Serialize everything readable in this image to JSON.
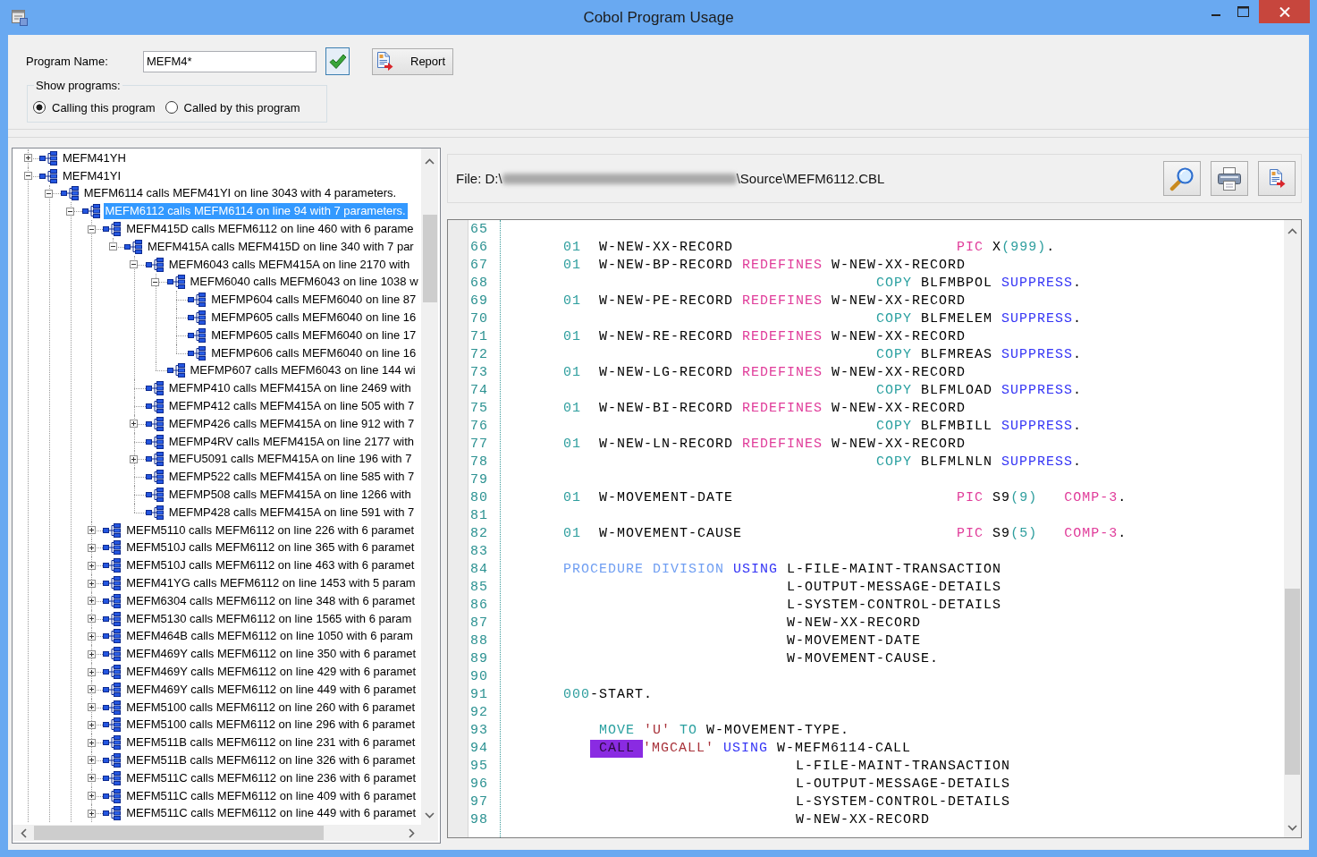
{
  "window": {
    "title": "Cobol Program Usage"
  },
  "program_name": {
    "label": "Program Name:",
    "value": "MEFM4*"
  },
  "report_button": {
    "label": "Report"
  },
  "show_programs": {
    "legend": "Show programs:",
    "options": [
      {
        "label": "Calling this program",
        "selected": true
      },
      {
        "label": "Called by this program",
        "selected": false
      }
    ]
  },
  "tree": {
    "items": [
      {
        "label": "MEFM41YH",
        "kind": "branch",
        "expanded": false,
        "selected": false
      },
      {
        "label": "MEFM41YI",
        "kind": "branch",
        "expanded": true,
        "selected": false,
        "children": [
          {
            "label": "MEFM6114 calls MEFM41YI on line 3043 with 4 parameters.",
            "kind": "branch",
            "expanded": true,
            "selected": false,
            "children": [
              {
                "label": "MEFM6112 calls MEFM6114 on line 94 with 7 parameters.",
                "kind": "branch",
                "expanded": true,
                "selected": true,
                "children": [
                  {
                    "label": "MEFM415D calls MEFM6112 on line 460 with 6 parame",
                    "kind": "branch",
                    "expanded": true,
                    "selected": false,
                    "children": [
                      {
                        "label": "MEFM415A calls MEFM415D on line 340 with 7 par",
                        "kind": "branch",
                        "expanded": true,
                        "selected": false,
                        "children": [
                          {
                            "label": "MEFM6043 calls MEFM415A on line 2170 with",
                            "kind": "branch",
                            "expanded": true,
                            "selected": false,
                            "children": [
                              {
                                "label": "MEFM6040 calls MEFM6043 on line 1038 w",
                                "kind": "branch",
                                "expanded": true,
                                "selected": false,
                                "children": [
                                  {
                                    "label": "MEFMP604 calls MEFM6040 on line 87",
                                    "kind": "leaf",
                                    "selected": false
                                  },
                                  {
                                    "label": "MEFMP605 calls MEFM6040 on line 16",
                                    "kind": "leaf",
                                    "selected": false
                                  },
                                  {
                                    "label": "MEFMP605 calls MEFM6040 on line 17",
                                    "kind": "leaf",
                                    "selected": false
                                  },
                                  {
                                    "label": "MEFMP606 calls MEFM6040 on line 16",
                                    "kind": "leaf",
                                    "selected": false
                                  }
                                ]
                              },
                              {
                                "label": "MEFMP607 calls MEFM6043 on line 144 wi",
                                "kind": "leaf",
                                "selected": false
                              }
                            ]
                          },
                          {
                            "label": "MEFMP410 calls MEFM415A on line 2469 with",
                            "kind": "leaf",
                            "selected": false
                          },
                          {
                            "label": "MEFMP412 calls MEFM415A on line 505 with 7",
                            "kind": "leaf",
                            "selected": false
                          },
                          {
                            "label": "MEFMP426 calls MEFM415A on line 912 with 7",
                            "kind": "branch",
                            "expanded": false,
                            "selected": false
                          },
                          {
                            "label": "MEFMP4RV calls MEFM415A on line 2177 with",
                            "kind": "leaf",
                            "selected": false
                          },
                          {
                            "label": "MEFU5091 calls MEFM415A on line 196 with 7",
                            "kind": "branch",
                            "expanded": false,
                            "selected": false
                          },
                          {
                            "label": "MEFMP522 calls MEFM415A on line 585 with 7",
                            "kind": "leaf",
                            "selected": false
                          },
                          {
                            "label": "MEFMP508 calls MEFM415A on line 1266 with",
                            "kind": "leaf",
                            "selected": false
                          },
                          {
                            "label": "MEFMP428 calls MEFM415A on line 591 with 7",
                            "kind": "leaf",
                            "selected": false
                          }
                        ]
                      }
                    ]
                  },
                  {
                    "label": "MEFM5110 calls MEFM6112 on line 226 with 6 paramet",
                    "kind": "branch",
                    "expanded": false,
                    "selected": false
                  },
                  {
                    "label": "MEFM510J calls MEFM6112 on line 365 with 6 paramet",
                    "kind": "branch",
                    "expanded": false,
                    "selected": false
                  },
                  {
                    "label": "MEFM510J calls MEFM6112 on line 463 with 6 paramet",
                    "kind": "branch",
                    "expanded": false,
                    "selected": false
                  },
                  {
                    "label": "MEFM41YG calls MEFM6112 on line 1453 with 5 param",
                    "kind": "branch",
                    "expanded": false,
                    "selected": false
                  },
                  {
                    "label": "MEFM6304 calls MEFM6112 on line 348 with 6 paramet",
                    "kind": "branch",
                    "expanded": false,
                    "selected": false
                  },
                  {
                    "label": "MEFM5130 calls MEFM6112 on line 1565 with 6 param",
                    "kind": "branch",
                    "expanded": false,
                    "selected": false
                  },
                  {
                    "label": "MEFM464B calls MEFM6112 on line 1050 with 6 param",
                    "kind": "branch",
                    "expanded": false,
                    "selected": false
                  },
                  {
                    "label": "MEFM469Y calls MEFM6112 on line 350 with 6 paramet",
                    "kind": "branch",
                    "expanded": false,
                    "selected": false
                  },
                  {
                    "label": "MEFM469Y calls MEFM6112 on line 429 with 6 paramet",
                    "kind": "branch",
                    "expanded": false,
                    "selected": false
                  },
                  {
                    "label": "MEFM469Y calls MEFM6112 on line 449 with 6 paramet",
                    "kind": "branch",
                    "expanded": false,
                    "selected": false
                  },
                  {
                    "label": "MEFM5100 calls MEFM6112 on line 260 with 6 paramet",
                    "kind": "branch",
                    "expanded": false,
                    "selected": false
                  },
                  {
                    "label": "MEFM5100 calls MEFM6112 on line 296 with 6 paramet",
                    "kind": "branch",
                    "expanded": false,
                    "selected": false
                  },
                  {
                    "label": "MEFM511B calls MEFM6112 on line 231 with 6 paramet",
                    "kind": "branch",
                    "expanded": false,
                    "selected": false
                  },
                  {
                    "label": "MEFM511B calls MEFM6112 on line 326 with 6 paramet",
                    "kind": "branch",
                    "expanded": false,
                    "selected": false
                  },
                  {
                    "label": "MEFM511C calls MEFM6112 on line 236 with 6 paramet",
                    "kind": "branch",
                    "expanded": false,
                    "selected": false
                  },
                  {
                    "label": "MEFM511C calls MEFM6112 on line 409 with 6 paramet",
                    "kind": "branch",
                    "expanded": false,
                    "selected": false
                  },
                  {
                    "label": "MEFM511C calls MEFM6112 on line 449 with 6 paramet",
                    "kind": "branch",
                    "expanded": false,
                    "selected": false
                  }
                ]
              }
            ]
          }
        ]
      }
    ]
  },
  "file_path": {
    "start": "File: D:\\",
    "end": "\\Source\\MEFM6112.CBL"
  },
  "editor": {
    "lines": [
      {
        "number": "65"
      },
      {
        "number": "66",
        "tokens": [
          {
            "kind": "number",
            "text": "       01"
          },
          {
            "kind": "plain",
            "text": "  W-NEW-XX-RECORD"
          },
          {
            "kind": "clause",
            "text": "                         PIC"
          },
          {
            "kind": "plain",
            "text": " X"
          },
          {
            "kind": "number",
            "text": "(999)"
          },
          {
            "kind": "plain",
            "text": "."
          }
        ]
      },
      {
        "number": "67",
        "tokens": [
          {
            "kind": "number",
            "text": "       01"
          },
          {
            "kind": "plain",
            "text": "  W-NEW-BP-RECORD"
          },
          {
            "kind": "clause",
            "text": " REDEFINES"
          },
          {
            "kind": "plain",
            "text": " W-NEW-XX-RECORD"
          }
        ]
      },
      {
        "number": "68",
        "tokens": [
          {
            "kind": "verb",
            "text": "                                          COPY"
          },
          {
            "kind": "plain",
            "text": " BLFMBPOL"
          },
          {
            "kind": "reserved",
            "text": " SUPPRESS"
          },
          {
            "kind": "plain",
            "text": "."
          }
        ]
      },
      {
        "number": "69",
        "tokens": [
          {
            "kind": "number",
            "text": "       01"
          },
          {
            "kind": "plain",
            "text": "  W-NEW-PE-RECORD"
          },
          {
            "kind": "clause",
            "text": " REDEFINES"
          },
          {
            "kind": "plain",
            "text": " W-NEW-XX-RECORD"
          }
        ]
      },
      {
        "number": "70",
        "tokens": [
          {
            "kind": "verb",
            "text": "                                          COPY"
          },
          {
            "kind": "plain",
            "text": " BLFMELEM"
          },
          {
            "kind": "reserved",
            "text": " SUPPRESS"
          },
          {
            "kind": "plain",
            "text": "."
          }
        ]
      },
      {
        "number": "71",
        "tokens": [
          {
            "kind": "number",
            "text": "       01"
          },
          {
            "kind": "plain",
            "text": "  W-NEW-RE-RECORD"
          },
          {
            "kind": "clause",
            "text": " REDEFINES"
          },
          {
            "kind": "plain",
            "text": " W-NEW-XX-RECORD"
          }
        ]
      },
      {
        "number": "72",
        "tokens": [
          {
            "kind": "verb",
            "text": "                                          COPY"
          },
          {
            "kind": "plain",
            "text": " BLFMREAS"
          },
          {
            "kind": "reserved",
            "text": " SUPPRESS"
          },
          {
            "kind": "plain",
            "text": "."
          }
        ]
      },
      {
        "number": "73",
        "tokens": [
          {
            "kind": "number",
            "text": "       01"
          },
          {
            "kind": "plain",
            "text": "  W-NEW-LG-RECORD"
          },
          {
            "kind": "clause",
            "text": " REDEFINES"
          },
          {
            "kind": "plain",
            "text": " W-NEW-XX-RECORD"
          }
        ]
      },
      {
        "number": "74",
        "tokens": [
          {
            "kind": "verb",
            "text": "                                          COPY"
          },
          {
            "kind": "plain",
            "text": " BLFMLOAD"
          },
          {
            "kind": "reserved",
            "text": " SUPPRESS"
          },
          {
            "kind": "plain",
            "text": "."
          }
        ]
      },
      {
        "number": "75",
        "tokens": [
          {
            "kind": "number",
            "text": "       01"
          },
          {
            "kind": "plain",
            "text": "  W-NEW-BI-RECORD"
          },
          {
            "kind": "clause",
            "text": " REDEFINES"
          },
          {
            "kind": "plain",
            "text": " W-NEW-XX-RECORD"
          }
        ]
      },
      {
        "number": "76",
        "tokens": [
          {
            "kind": "verb",
            "text": "                                          COPY"
          },
          {
            "kind": "plain",
            "text": " BLFMBILL"
          },
          {
            "kind": "reserved",
            "text": " SUPPRESS"
          },
          {
            "kind": "plain",
            "text": "."
          }
        ]
      },
      {
        "number": "77",
        "tokens": [
          {
            "kind": "number",
            "text": "       01"
          },
          {
            "kind": "plain",
            "text": "  W-NEW-LN-RECORD"
          },
          {
            "kind": "clause",
            "text": " REDEFINES"
          },
          {
            "kind": "plain",
            "text": " W-NEW-XX-RECORD"
          }
        ]
      },
      {
        "number": "78",
        "tokens": [
          {
            "kind": "verb",
            "text": "                                          COPY"
          },
          {
            "kind": "plain",
            "text": " BLFMLNLN"
          },
          {
            "kind": "reserved",
            "text": " SUPPRESS"
          },
          {
            "kind": "plain",
            "text": "."
          }
        ]
      },
      {
        "number": "79"
      },
      {
        "number": "80",
        "tokens": [
          {
            "kind": "number",
            "text": "       01"
          },
          {
            "kind": "plain",
            "text": "  W-MOVEMENT-DATE"
          },
          {
            "kind": "clause",
            "text": "                         PIC"
          },
          {
            "kind": "plain",
            "text": " S9"
          },
          {
            "kind": "number",
            "text": "(9)"
          },
          {
            "kind": "clause",
            "text": "   COMP-3"
          },
          {
            "kind": "plain",
            "text": "."
          }
        ]
      },
      {
        "number": "81"
      },
      {
        "number": "82",
        "tokens": [
          {
            "kind": "number",
            "text": "       01"
          },
          {
            "kind": "plain",
            "text": "  W-MOVEMENT-CAUSE"
          },
          {
            "kind": "clause",
            "text": "                        PIC"
          },
          {
            "kind": "plain",
            "text": " S9"
          },
          {
            "kind": "number",
            "text": "(5)"
          },
          {
            "kind": "clause",
            "text": "   COMP-3"
          },
          {
            "kind": "plain",
            "text": "."
          }
        ]
      },
      {
        "number": "83"
      },
      {
        "number": "84",
        "tokens": [
          {
            "kind": "division",
            "text": "       PROCEDURE DIVISION"
          },
          {
            "kind": "reserved",
            "text": " USING"
          },
          {
            "kind": "plain",
            "text": " L-FILE-MAINT-TRANSACTION"
          }
        ]
      },
      {
        "number": "85",
        "tokens": [
          {
            "kind": "plain",
            "text": "                                L-OUTPUT-MESSAGE-DETAILS"
          }
        ]
      },
      {
        "number": "86",
        "tokens": [
          {
            "kind": "plain",
            "text": "                                L-SYSTEM-CONTROL-DETAILS"
          }
        ]
      },
      {
        "number": "87",
        "tokens": [
          {
            "kind": "plain",
            "text": "                                W-NEW-XX-RECORD"
          }
        ]
      },
      {
        "number": "88",
        "tokens": [
          {
            "kind": "plain",
            "text": "                                W-MOVEMENT-DATE"
          }
        ]
      },
      {
        "number": "89",
        "tokens": [
          {
            "kind": "plain",
            "text": "                                W-MOVEMENT-CAUSE."
          }
        ]
      },
      {
        "number": "90"
      },
      {
        "number": "91",
        "tokens": [
          {
            "kind": "number",
            "text": "       000"
          },
          {
            "kind": "plain",
            "text": "-START."
          }
        ]
      },
      {
        "number": "92"
      },
      {
        "number": "93",
        "tokens": [
          {
            "kind": "verb",
            "text": "           MOVE"
          },
          {
            "kind": "literal",
            "text": " 'U'"
          },
          {
            "kind": "verb",
            "text": " TO"
          },
          {
            "kind": "plain",
            "text": " W-MOVEMENT-TYPE."
          }
        ]
      },
      {
        "number": "94",
        "tokens": [
          {
            "kind": "match",
            "text": "          CALL"
          },
          {
            "kind": "literal",
            "text": "'MGCALL'"
          },
          {
            "kind": "reserved",
            "text": " USING"
          },
          {
            "kind": "plain",
            "text": " W-MEFM6114-CALL"
          }
        ]
      },
      {
        "number": "95",
        "tokens": [
          {
            "kind": "plain",
            "text": "                                 L-FILE-MAINT-TRANSACTION"
          }
        ]
      },
      {
        "number": "96",
        "tokens": [
          {
            "kind": "plain",
            "text": "                                 L-OUTPUT-MESSAGE-DETAILS"
          }
        ]
      },
      {
        "number": "97",
        "tokens": [
          {
            "kind": "plain",
            "text": "                                 L-SYSTEM-CONTROL-DETAILS"
          }
        ]
      },
      {
        "number": "98",
        "tokens": [
          {
            "kind": "plain",
            "text": "                                 W-NEW-XX-RECORD"
          }
        ]
      }
    ]
  }
}
